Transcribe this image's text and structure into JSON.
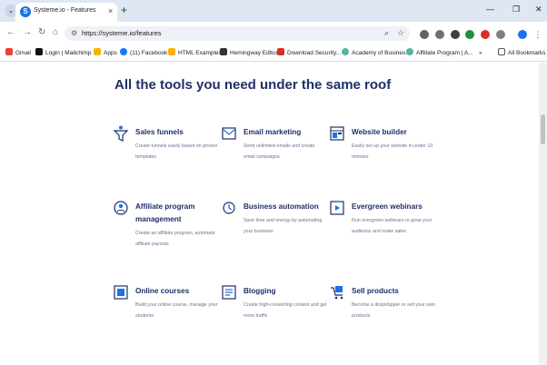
{
  "browser": {
    "tab_title": "Systeme.io - Features",
    "favicon": "S",
    "url": "https://systeme.io/features",
    "bookmarks": [
      "Gmail",
      "Login | Mailchimp",
      "Apps",
      "(11) Facebook",
      "HTML Examples",
      "Hemingway Editor",
      "Download Security...",
      "Academy of Busines...",
      "Affiliate Program | A...",
      "All Bookmarks"
    ]
  },
  "page": {
    "heading": "All the tools you need under the same roof",
    "features": [
      {
        "title": "Sales funnels",
        "description": "Create funnels easily based on proven templates",
        "icon": "funnel-icon"
      },
      {
        "title": "Email marketing",
        "description": "Send unlimited emails and create email campaigns",
        "icon": "email-icon"
      },
      {
        "title": "Website builder",
        "description": "Easily set up your website in under 10 minutes",
        "icon": "website-builder-icon"
      },
      {
        "title": "Affiliate program management",
        "description": "Create an affiliate program, automate affiliate payouts",
        "icon": "affiliate-icon"
      },
      {
        "title": "Business automation",
        "description": "Save time and energy by automating your business",
        "icon": "automation-icon"
      },
      {
        "title": "Evergreen webinars",
        "description": "Run evergreen webinars to grow your audience and make sales",
        "icon": "webinar-icon"
      },
      {
        "title": "Online courses",
        "description": "Build your online course, manage your students",
        "icon": "course-icon"
      },
      {
        "title": "Blogging",
        "description": "Create high-converting content and get more traffic",
        "icon": "blog-icon"
      },
      {
        "title": "Sell products",
        "description": "Become a dropshipper or sell your own products",
        "icon": "cart-icon"
      }
    ]
  },
  "colors": {
    "heading": "#1f2f68",
    "icon_blue": "#1a73e8",
    "icon_dark": "#1f2f68"
  }
}
